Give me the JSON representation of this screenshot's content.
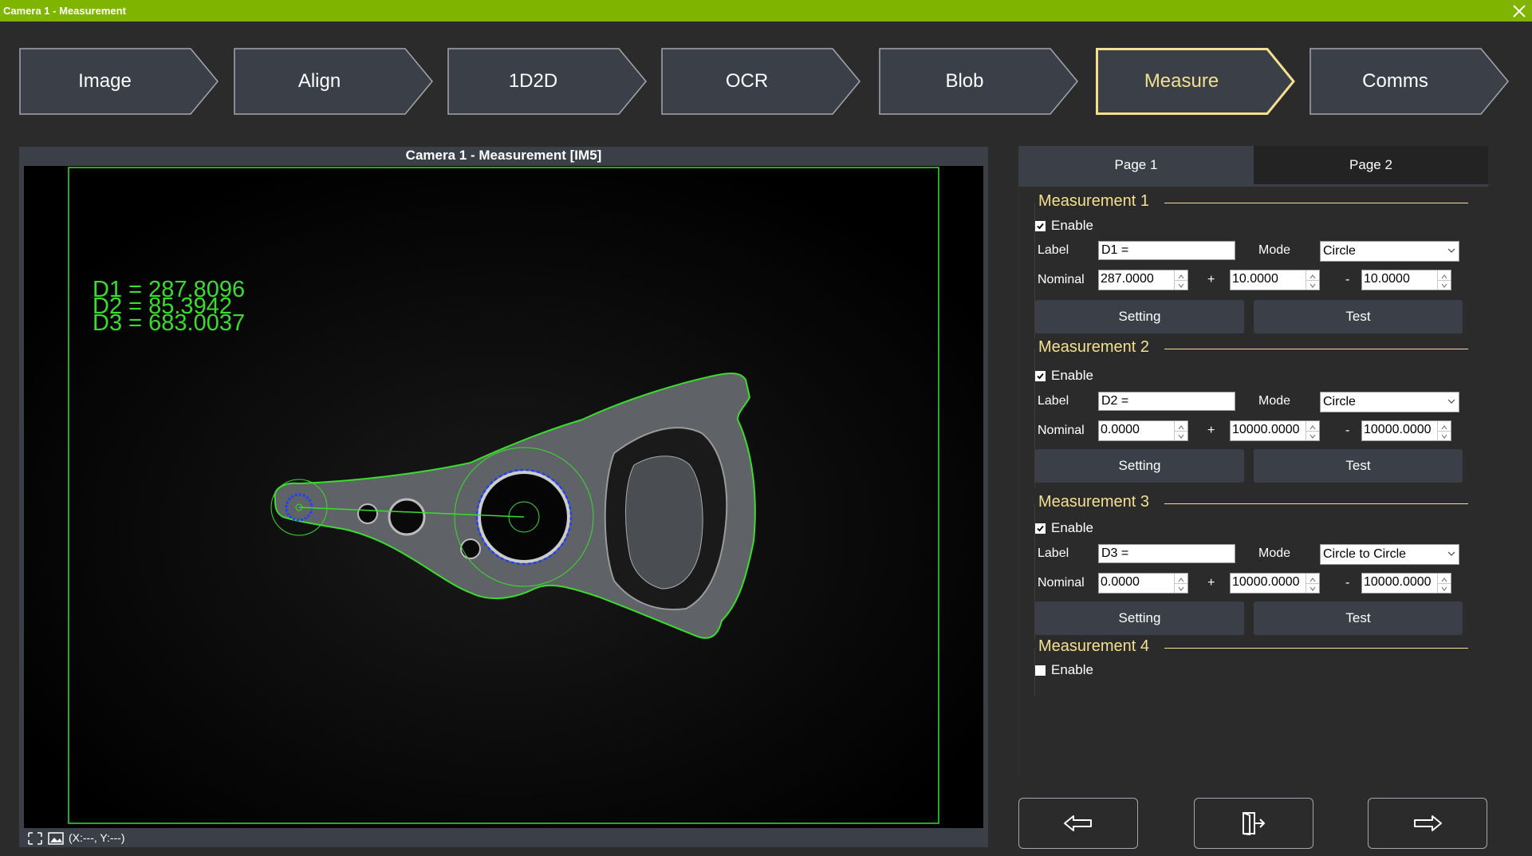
{
  "window": {
    "title": "Camera 1 - Measurement"
  },
  "steps": [
    {
      "label": "Image"
    },
    {
      "label": "Align"
    },
    {
      "label": "1D2D"
    },
    {
      "label": "OCR"
    },
    {
      "label": "Blob"
    },
    {
      "label": "Measure",
      "active": true
    },
    {
      "label": "Comms"
    }
  ],
  "image_panel": {
    "title": "Camera 1 -  Measurement  [IM5]",
    "results": [
      "D1 = 287.8096",
      "D2 = 85.3942",
      "D3 = 683.0037"
    ],
    "coords": "(X:---, Y:---)"
  },
  "tabs": {
    "page1": "Page 1",
    "page2": "Page 2",
    "active": "page1"
  },
  "measurements": [
    {
      "title": "Measurement 1",
      "enable_label": "Enable",
      "enabled": true,
      "label_caption": "Label",
      "label_value": "D1 =",
      "mode_caption": "Mode",
      "mode_value": "Circle",
      "nominal_caption": "Nominal",
      "nominal": "287.0000",
      "plus_sign": "+",
      "plus": "10.0000",
      "minus_sign": "-",
      "minus": "10.0000",
      "setting_label": "Setting",
      "test_label": "Test"
    },
    {
      "title": "Measurement 2",
      "enable_label": "Enable",
      "enabled": true,
      "label_caption": "Label",
      "label_value": "D2 =",
      "mode_caption": "Mode",
      "mode_value": "Circle",
      "nominal_caption": "Nominal",
      "nominal": "0.0000",
      "plus_sign": "+",
      "plus": "10000.0000",
      "minus_sign": "-",
      "minus": "10000.0000",
      "setting_label": "Setting",
      "test_label": "Test"
    },
    {
      "title": "Measurement 3",
      "enable_label": "Enable",
      "enabled": true,
      "label_caption": "Label",
      "label_value": "D3 =",
      "mode_caption": "Mode",
      "mode_value": "Circle to Circle",
      "nominal_caption": "Nominal",
      "nominal": "0.0000",
      "plus_sign": "+",
      "plus": "10000.0000",
      "minus_sign": "-",
      "minus": "10000.0000",
      "setting_label": "Setting",
      "test_label": "Test"
    },
    {
      "title": "Measurement 4",
      "enable_label": "Enable",
      "enabled": false
    }
  ],
  "nav": {
    "back_icon": "arrow-left-icon",
    "exit_icon": "door-exit-icon",
    "next_icon": "arrow-right-icon"
  },
  "colors": {
    "titlebar": "#7fb500",
    "accent": "#f3e08f",
    "overlay_green": "#3adc2e",
    "overlay_blue": "#2040ff",
    "panel": "#3b4048"
  }
}
